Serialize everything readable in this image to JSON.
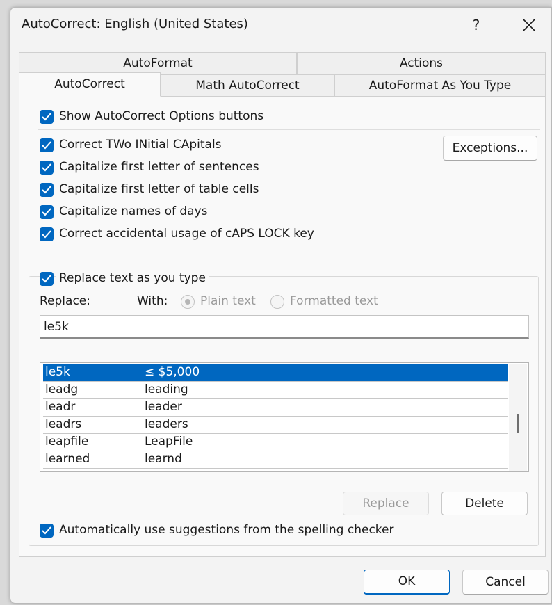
{
  "window": {
    "title": "AutoCorrect: English (United States)",
    "help_label": "?"
  },
  "tabs": {
    "row1": [
      "AutoFormat",
      "Actions"
    ],
    "row2": [
      "AutoCorrect",
      "Math AutoCorrect",
      "AutoFormat As You Type"
    ],
    "active": "AutoCorrect"
  },
  "options": {
    "show_buttons": "Show AutoCorrect Options buttons",
    "two_initial": "Correct TWo INitial CApitals",
    "first_sentence": "Capitalize first letter of sentences",
    "first_table_cell": "Capitalize first letter of table cells",
    "names_days": "Capitalize names of days",
    "caps_lock": "Correct accidental usage of cAPS LOCK key",
    "replace_as_type": "Replace text as you type",
    "auto_suggest": "Automatically use suggestions from the spelling checker"
  },
  "buttons": {
    "exceptions": "Exceptions...",
    "replace": "Replace",
    "delete": "Delete",
    "ok": "OK",
    "cancel": "Cancel"
  },
  "replace_section": {
    "replace_label": "Replace:",
    "with_label": "With:",
    "plain_text": "Plain text",
    "formatted_text": "Formatted text",
    "replace_value": "le5k",
    "with_value": ""
  },
  "entries": [
    {
      "from": "le5k",
      "to": "≤ $5,000"
    },
    {
      "from": "leadg",
      "to": "leading"
    },
    {
      "from": "leadr",
      "to": "leader"
    },
    {
      "from": "leadrs",
      "to": "leaders"
    },
    {
      "from": "leapfile",
      "to": "LeapFile"
    },
    {
      "from": "learned",
      "to": "learnd"
    }
  ],
  "colors": {
    "accent": "#0067c0",
    "dialog_bg": "#f3f3f3"
  }
}
